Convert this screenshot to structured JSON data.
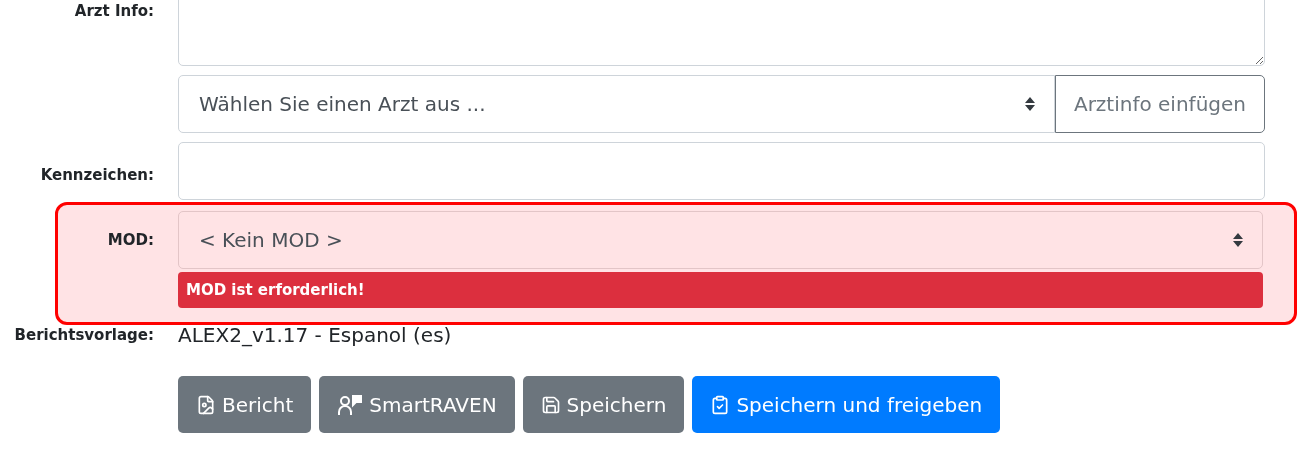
{
  "arzt_info": {
    "label": "Arzt Info:"
  },
  "arzt_select": {
    "placeholder": "Wählen Sie einen Arzt aus ...",
    "button": "Arztinfo einfügen"
  },
  "kennzeichen": {
    "label": "Kennzeichen:"
  },
  "mod": {
    "label": "MOD:",
    "value": "< Kein MOD >",
    "highlighted": true,
    "error": "MOD ist erforderlich!"
  },
  "berichtsvorlage": {
    "label": "Berichtsvorlage:",
    "value": "ALEX2_v1.17 - Espanol (es)"
  },
  "buttons": [
    {
      "label": "Bericht",
      "kind": "secondary"
    },
    {
      "label": "SmartRAVEN",
      "kind": "secondary"
    },
    {
      "label": "Speichern",
      "kind": "secondary"
    },
    {
      "label": "Speichern und freigeben",
      "kind": "primary"
    }
  ]
}
